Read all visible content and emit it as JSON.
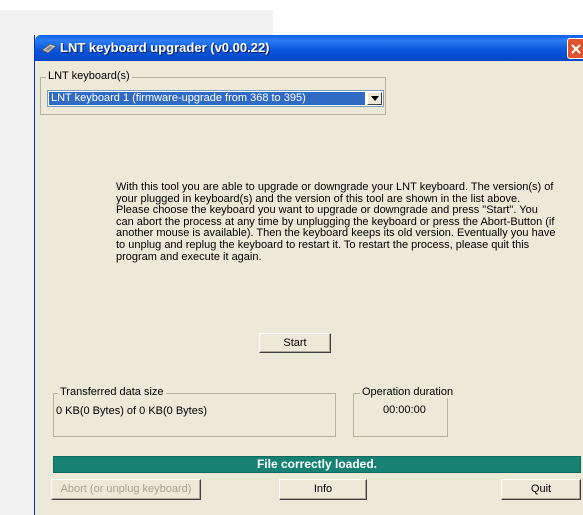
{
  "window": {
    "title": "LNT keyboard upgrader (v0.00.22)"
  },
  "keyboards_group": {
    "label": "LNT keyboard(s)",
    "selected": "LNT keyboard 1 (firmware-upgrade from 368 to 395)"
  },
  "description": "With this tool you are able to upgrade or downgrade your LNT keyboard. The version(s) of your plugged in keyboard(s) and the version of this tool are shown in the list above. Please choose the keyboard you want to upgrade or downgrade and press \"Start\". You can abort the process at any time by unplugging the keyboard or press the Abort-Button (if another mouse is available). Then the keyboard keeps its old version. Eventually you have to unplug and replug the keyboard to restart it. To restart the process, please quit this program and execute it again.",
  "start_button": "Start",
  "transfer_group": {
    "label": "Transferred data size",
    "value": "0 KB(0 Bytes) of 0 KB(0 Bytes)"
  },
  "duration_group": {
    "label": "Operation duration",
    "value": "00:00:00"
  },
  "status": "File correctly loaded.",
  "buttons": {
    "abort": "Abort (or unplug keyboard)",
    "info": "Info",
    "quit": "Quit"
  },
  "colors": {
    "titlebar": "#0a54d8",
    "status_bar": "#178173",
    "selection": "#316ac5",
    "window_bg": "#ece9d8"
  }
}
